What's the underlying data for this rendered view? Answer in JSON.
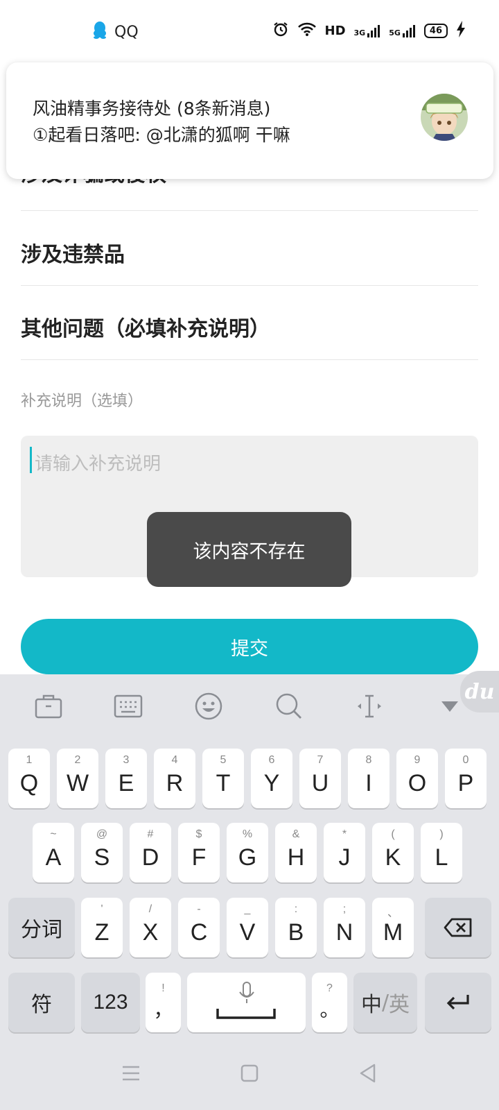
{
  "status_bar": {
    "app_name": "QQ",
    "network_hd": "HD",
    "net1": "3G",
    "net2": "5G",
    "battery": "46"
  },
  "notification": {
    "title": "风油精事务接待处 (8条新消息)",
    "message": "①起看日落吧: @北潇的狐啊 干嘛"
  },
  "report_options": [
    "涉及诈骗或侵权",
    "涉及违禁品",
    "其他问题（必填补充说明）"
  ],
  "supplement": {
    "label": "补充说明（选填）",
    "placeholder": "请输入补充说明"
  },
  "toast": "该内容不存在",
  "submit_label": "提交",
  "keyboard": {
    "brand": "du",
    "row1": [
      {
        "main": "Q",
        "sub": "1"
      },
      {
        "main": "W",
        "sub": "2"
      },
      {
        "main": "E",
        "sub": "3"
      },
      {
        "main": "R",
        "sub": "4"
      },
      {
        "main": "T",
        "sub": "5"
      },
      {
        "main": "Y",
        "sub": "6"
      },
      {
        "main": "U",
        "sub": "7"
      },
      {
        "main": "I",
        "sub": "8"
      },
      {
        "main": "O",
        "sub": "9"
      },
      {
        "main": "P",
        "sub": "0"
      }
    ],
    "row2": [
      {
        "main": "A",
        "sub": "~"
      },
      {
        "main": "S",
        "sub": "@"
      },
      {
        "main": "D",
        "sub": "#"
      },
      {
        "main": "F",
        "sub": "$"
      },
      {
        "main": "G",
        "sub": "%"
      },
      {
        "main": "H",
        "sub": "&"
      },
      {
        "main": "J",
        "sub": "*"
      },
      {
        "main": "K",
        "sub": "("
      },
      {
        "main": "L",
        "sub": ")"
      }
    ],
    "row3": [
      {
        "main": "Z",
        "sub": "'"
      },
      {
        "main": "X",
        "sub": "/"
      },
      {
        "main": "C",
        "sub": "-"
      },
      {
        "main": "V",
        "sub": "_"
      },
      {
        "main": "B",
        "sub": ":"
      },
      {
        "main": "N",
        "sub": ";"
      },
      {
        "main": "M",
        "sub": "、"
      }
    ],
    "fenci": "分词",
    "fu": "符",
    "num": "123",
    "comma_main": "，",
    "comma_sub": "!",
    "period_main": "。",
    "period_sub": "?",
    "zh": "中",
    "sep": "/",
    "en": "英"
  }
}
